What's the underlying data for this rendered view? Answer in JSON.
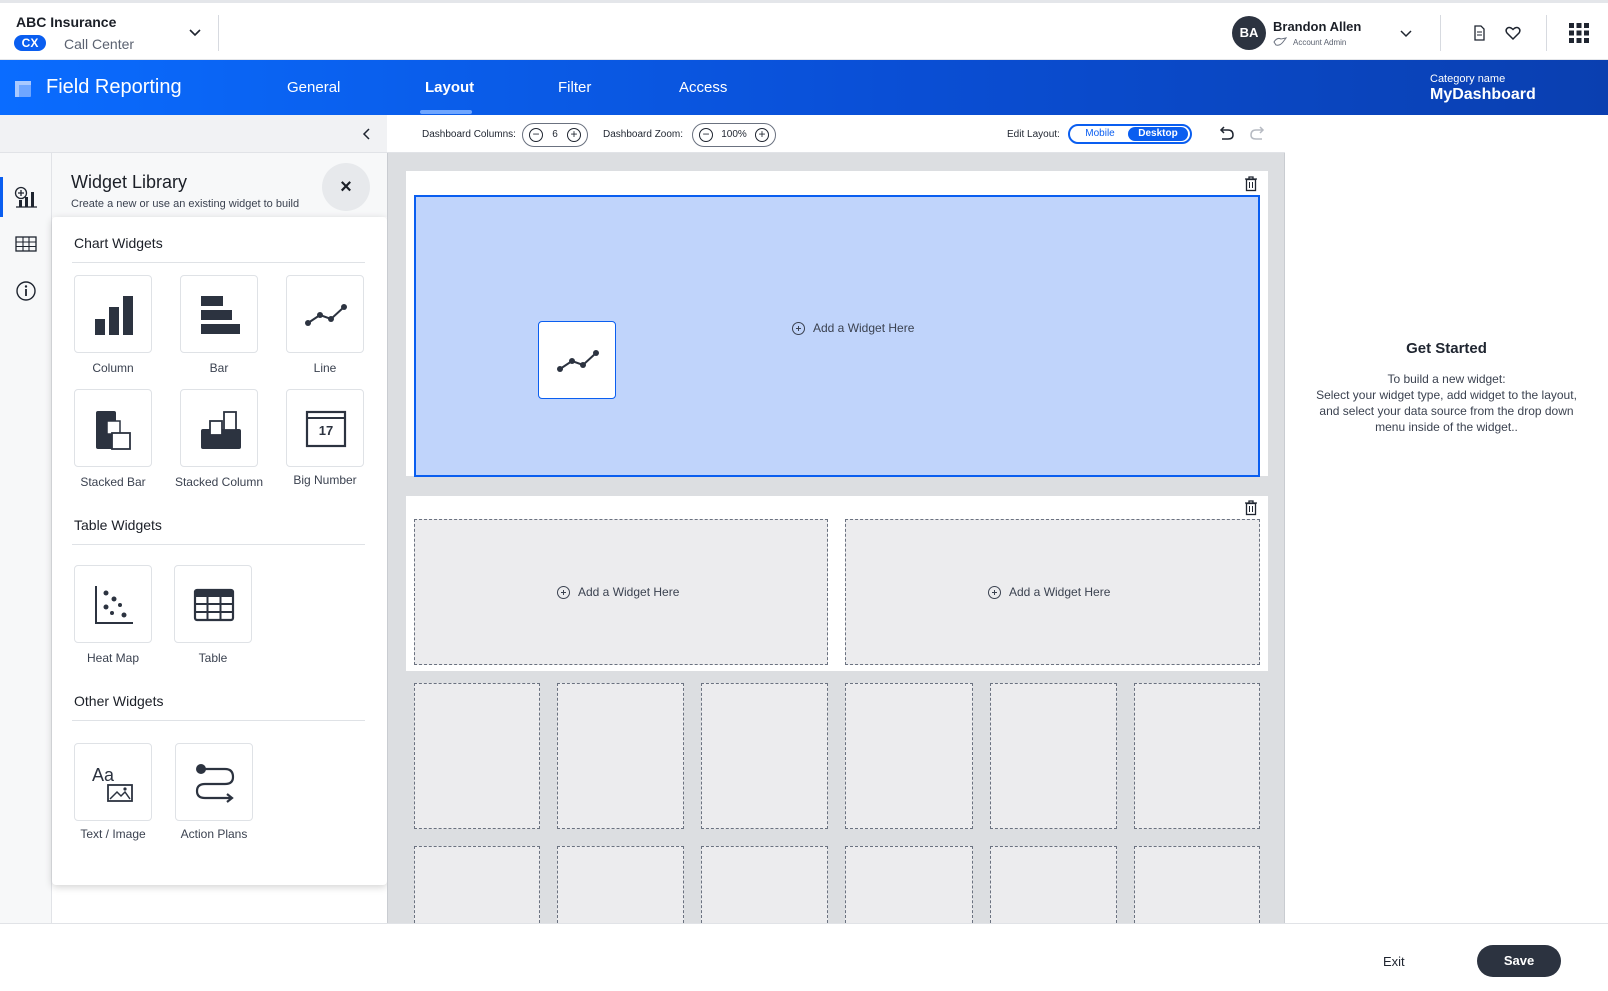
{
  "header": {
    "org_name": "ABC Insurance",
    "product_badge": "CX",
    "product_name": "Call Center",
    "user_initials": "BA",
    "user_name": "Brandon Allen",
    "user_role": "Account Admin"
  },
  "appbar": {
    "title": "Field Reporting",
    "tabs": [
      {
        "label": "General"
      },
      {
        "label": "Layout"
      },
      {
        "label": "Filter"
      },
      {
        "label": "Access"
      }
    ],
    "active_tab": "Layout",
    "category_label": "Category name",
    "category_value": "MyDashboard"
  },
  "library": {
    "title": "Widget Library",
    "description": "Create a new or use an existing widget to build your dashboard",
    "close_label": "×",
    "chart_section": "Chart Widgets",
    "chart_widgets": [
      {
        "label": "Column",
        "icon": "column-chart-icon"
      },
      {
        "label": "Bar",
        "icon": "bar-chart-icon"
      },
      {
        "label": "Line",
        "icon": "line-chart-icon"
      },
      {
        "label": "Stacked Bar",
        "icon": "stacked-bar-icon"
      },
      {
        "label": "Stacked Column",
        "icon": "stacked-column-icon"
      },
      {
        "label": "Big Number",
        "icon": "big-number-icon"
      }
    ],
    "big_number_value": "17",
    "table_section": "Table Widgets",
    "table_widgets": [
      {
        "label": "Heat Map",
        "icon": "heat-map-icon"
      },
      {
        "label": "Table",
        "icon": "table-icon"
      }
    ],
    "other_section": "Other Widgets",
    "other_widgets": [
      {
        "label": "Text / Image",
        "icon": "text-image-icon"
      },
      {
        "label": "Action Plans",
        "icon": "action-plans-icon"
      }
    ],
    "text_icon_letters": "Aa"
  },
  "toolbar": {
    "columns_label": "Dashboard Columns:",
    "columns_value": "6",
    "zoom_label": "Dashboard Zoom:",
    "zoom_value": "100%",
    "edit_layout_label": "Edit Layout:",
    "mobile_label": "Mobile",
    "desktop_label": "Desktop",
    "selected_layout": "Desktop"
  },
  "canvas": {
    "add_widget_label": "Add a Widget Here"
  },
  "get_started": {
    "title": "Get Started",
    "line1": "To build a new widget:",
    "line2": "Select your widget type, add widget to the layout, and select your data source from the drop down menu inside of the widget.."
  },
  "footer": {
    "exit_label": "Exit",
    "save_label": "Save"
  },
  "colors": {
    "brand_blue": "#0a5ef0",
    "dark": "#2c3340",
    "selected_slot": "#c0d4fb"
  }
}
